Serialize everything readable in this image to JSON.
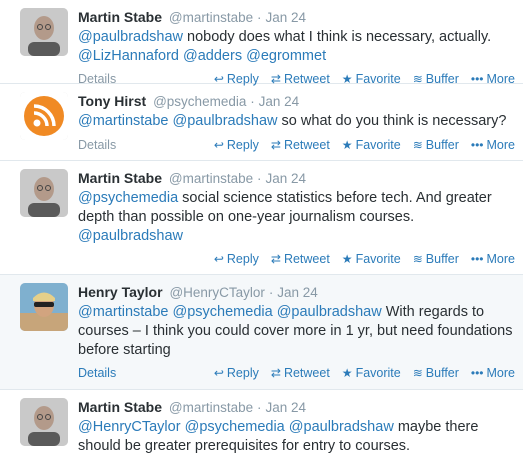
{
  "actions": {
    "reply": "Reply",
    "retweet": "Retweet",
    "favorite": "Favorite",
    "buffer": "Buffer",
    "more": "More",
    "details": "Details"
  },
  "icons": {
    "reply": "reply-icon",
    "retweet": "retweet-icon",
    "favorite": "star-icon",
    "buffer": "buffer-icon",
    "more": "more-dots-icon"
  },
  "colors": {
    "link": "#2b7bb9",
    "muted": "#8899a6",
    "highlight_bg": "#f5f8fa"
  },
  "tweets": [
    {
      "name": "Martin Stabe",
      "handle": "@martinstabe",
      "dot": "·",
      "time": "Jan 24",
      "text_segments": [
        {
          "t": "@paulbradshaw",
          "m": true
        },
        {
          "t": " nobody does what I think is necessary, actually. ",
          "m": false
        },
        {
          "t": "@LizHannaford",
          "m": true
        },
        {
          "t": " ",
          "m": false
        },
        {
          "t": "@adders",
          "m": true
        },
        {
          "t": " ",
          "m": false
        },
        {
          "t": "@egrommet",
          "m": true
        }
      ]
    },
    {
      "name": "Tony Hirst",
      "handle": "@psychemedia",
      "dot": "·",
      "time": "Jan 24",
      "text_segments": [
        {
          "t": "@martinstabe",
          "m": true
        },
        {
          "t": " ",
          "m": false
        },
        {
          "t": "@paulbradshaw",
          "m": true
        },
        {
          "t": " so what do you think is necessary?",
          "m": false
        }
      ]
    },
    {
      "name": "Martin Stabe",
      "handle": "@martinstabe",
      "dot": "·",
      "time": "Jan 24",
      "text_segments": [
        {
          "t": "@psychemedia",
          "m": true
        },
        {
          "t": " social science statistics before tech. And greater depth than possible on one-year journalism courses. ",
          "m": false
        },
        {
          "t": "@paulbradshaw",
          "m": true
        }
      ]
    },
    {
      "name": "Henry Taylor",
      "handle": "@HenryCTaylor",
      "dot": "·",
      "time": "Jan 24",
      "text_segments": [
        {
          "t": "@martinstabe",
          "m": true
        },
        {
          "t": " ",
          "m": false
        },
        {
          "t": "@psychemedia",
          "m": true
        },
        {
          "t": " ",
          "m": false
        },
        {
          "t": "@paulbradshaw",
          "m": true
        },
        {
          "t": " With regards to courses – I think you could cover more in 1 yr, but need foundations before starting",
          "m": false
        }
      ]
    },
    {
      "name": "Martin Stabe",
      "handle": "@martinstabe",
      "dot": "·",
      "time": "Jan 24",
      "text_segments": [
        {
          "t": "@HenryCTaylor",
          "m": true
        },
        {
          "t": " ",
          "m": false
        },
        {
          "t": "@psychemedia",
          "m": true
        },
        {
          "t": " ",
          "m": false
        },
        {
          "t": "@paulbradshaw",
          "m": true
        },
        {
          "t": " maybe there should be greater prerequisites for entry to courses.",
          "m": false
        }
      ]
    }
  ]
}
